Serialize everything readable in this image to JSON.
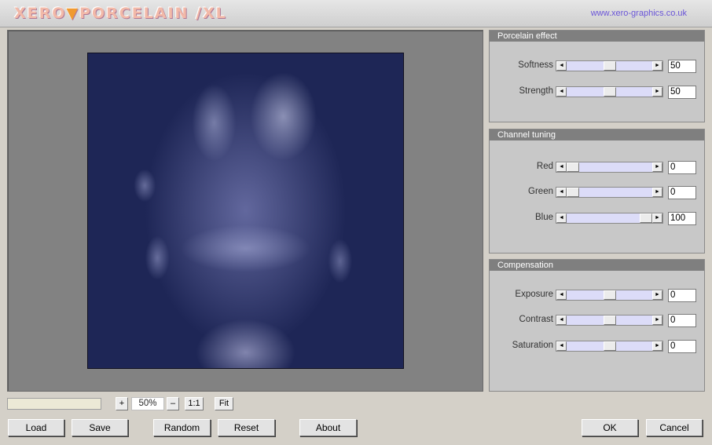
{
  "header": {
    "logo_left": "XERO",
    "logo_arrow": "▼",
    "logo_right": "PORCELAIN /XL",
    "url": "www.xero-graphics.co.uk"
  },
  "panels": {
    "porcelain": {
      "title": "Porcelain effect",
      "sliders": [
        {
          "label": "Softness",
          "value": "50",
          "level": 0.5
        },
        {
          "label": "Strength",
          "value": "50",
          "level": 0.5
        }
      ]
    },
    "channel": {
      "title": "Channel tuning",
      "sliders": [
        {
          "label": "Red",
          "value": "0",
          "level": 0.0
        },
        {
          "label": "Green",
          "value": "0",
          "level": 0.0
        },
        {
          "label": "Blue",
          "value": "100",
          "level": 1.0
        }
      ]
    },
    "compensation": {
      "title": "Compensation",
      "sliders": [
        {
          "label": "Exposure",
          "value": "0",
          "level": 0.5
        },
        {
          "label": "Contrast",
          "value": "0",
          "level": 0.5
        },
        {
          "label": "Saturation",
          "value": "0",
          "level": 0.5
        }
      ]
    }
  },
  "zoom": {
    "plus": "+",
    "value": "50%",
    "minus": "–",
    "one_to_one": "1:1",
    "fit": "Fit"
  },
  "buttons": {
    "load": "Load",
    "save": "Save",
    "random": "Random",
    "reset": "Reset",
    "about": "About",
    "ok": "OK",
    "cancel": "Cancel"
  },
  "icons": {
    "scroll_left": "◄",
    "scroll_right": "►"
  },
  "colors": {
    "track": "#dcdcf8",
    "panel_title_bg": "#7f7f7f",
    "preview_bg": "#828282"
  }
}
